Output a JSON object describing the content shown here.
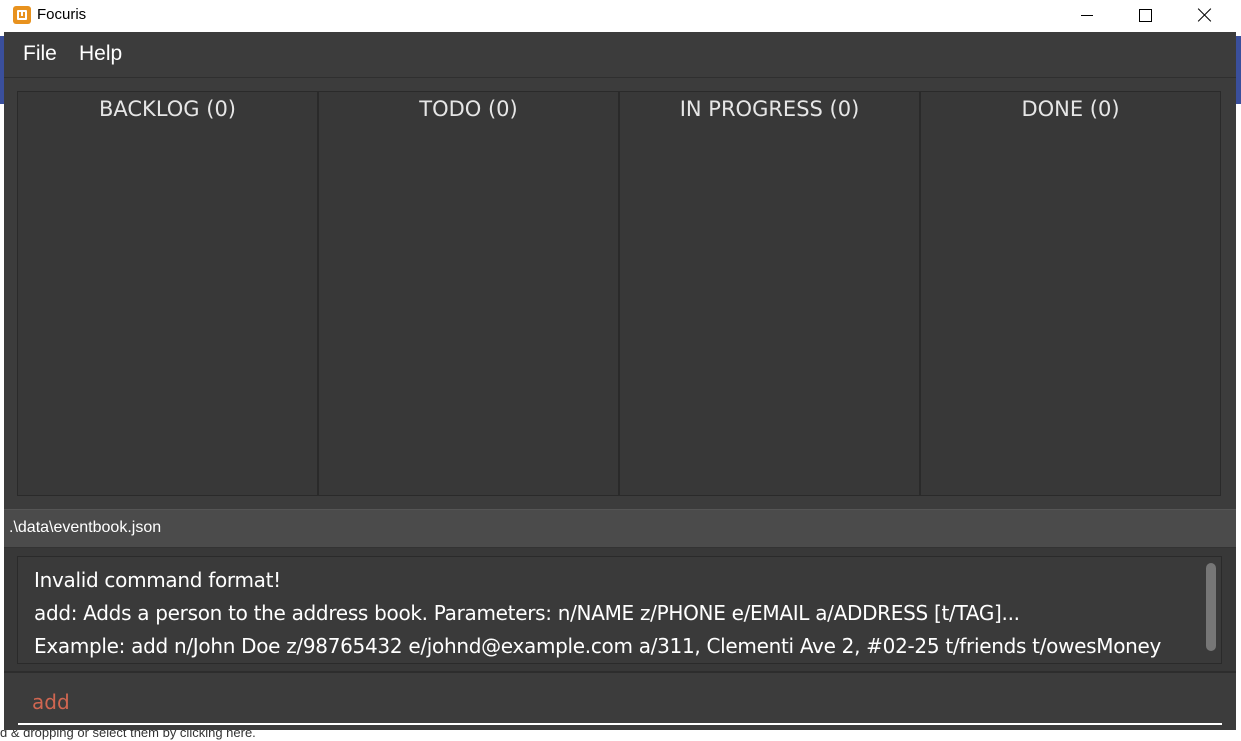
{
  "window": {
    "title": "Focuris",
    "controls": {
      "minimize_icon": "minimize-icon",
      "maximize_icon": "maximize-icon",
      "close_icon": "close-icon"
    }
  },
  "menu": {
    "items": [
      {
        "label": "File"
      },
      {
        "label": "Help"
      }
    ]
  },
  "board": {
    "columns": [
      {
        "title": "BACKLOG (0)"
      },
      {
        "title": "TODO (0)"
      },
      {
        "title": "IN PROGRESS (0)"
      },
      {
        "title": "DONE (0)"
      }
    ]
  },
  "status": {
    "path": ".\\data\\eventbook.json"
  },
  "result": {
    "lines": [
      "Invalid command format!",
      "add: Adds a person to the address book. Parameters: n/NAME z/PHONE e/EMAIL a/ADDRESS [t/TAG]...",
      "Example: add n/John Doe z/98765432 e/johnd@example.com a/311, Clementi Ave 2, #02-25 t/friends t/owesMoney"
    ]
  },
  "command": {
    "value": "add"
  },
  "colors": {
    "window_bg": "#3c3c3c",
    "column_bg": "#383838",
    "command_text": "#d06651",
    "app_icon": "#e8921e"
  },
  "background": {
    "bottom_text": "d & dropping or select them by clicking here."
  }
}
